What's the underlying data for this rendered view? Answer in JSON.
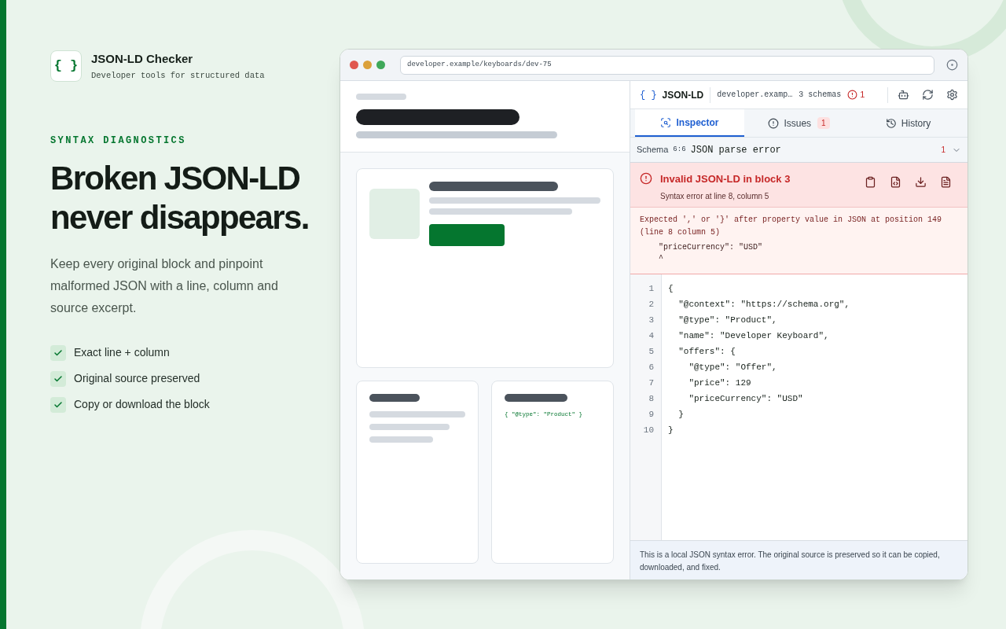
{
  "brand": {
    "glyph": "{ }",
    "name": "JSON-LD Checker",
    "tagline": "Developer tools for structured data"
  },
  "eyebrow": "SYNTAX DIAGNOSTICS",
  "headline": [
    "Broken JSON-LD",
    "never disappears."
  ],
  "lead": "Keep every original block and pinpoint malformed JSON with a line, column and source excerpt.",
  "features": [
    "Exact line + column",
    "Original source preserved",
    "Copy or download the block"
  ],
  "browser": {
    "url": "developer.example/keyboards/dev-75"
  },
  "page_preview": {
    "snippet": "{ \"@type\": \"Product\" }"
  },
  "panel": {
    "glyph": "{ }",
    "title": "JSON-LD",
    "site": "developer.examp…",
    "schemas": "3 schemas",
    "error_count": "1",
    "tabs": [
      {
        "label": "Inspector",
        "kind": "inspector",
        "selected": true
      },
      {
        "label": "Issues",
        "kind": "issues",
        "selected": false,
        "badge": "1"
      },
      {
        "label": "History",
        "kind": "history",
        "selected": false
      }
    ],
    "schema_row": {
      "label": "Schema",
      "position": "6:6",
      "title": "JSON parse error",
      "count": "1",
      "expanded": false
    },
    "error": {
      "title": "Invalid JSON-LD in block 3",
      "subtitle": "Syntax error at line 8, column 5",
      "message": [
        "Expected ',' or '}' after property value in JSON at position 149",
        "(line 8 column 5)"
      ],
      "excerpt": [
        "  \"priceCurrency\": \"USD\"",
        "  ^"
      ]
    },
    "code": [
      {
        "number": "1",
        "text": "{"
      },
      {
        "number": "2",
        "text": "  \"@context\": \"https://schema.org\","
      },
      {
        "number": "3",
        "text": "  \"@type\": \"Product\","
      },
      {
        "number": "4",
        "text": "  \"name\": \"Developer Keyboard\","
      },
      {
        "number": "5",
        "text": "  \"offers\": {"
      },
      {
        "number": "6",
        "text": "    \"@type\": \"Offer\","
      },
      {
        "number": "7",
        "text": "    \"price\": 129"
      },
      {
        "number": "8",
        "text": "    \"priceCurrency\": \"USD\""
      },
      {
        "number": "9",
        "text": "  }"
      },
      {
        "number": "10",
        "text": "}"
      }
    ],
    "footer": "This is a local JSON syntax error. The original source is preserved so it can be copied, downloaded, and fixed."
  }
}
